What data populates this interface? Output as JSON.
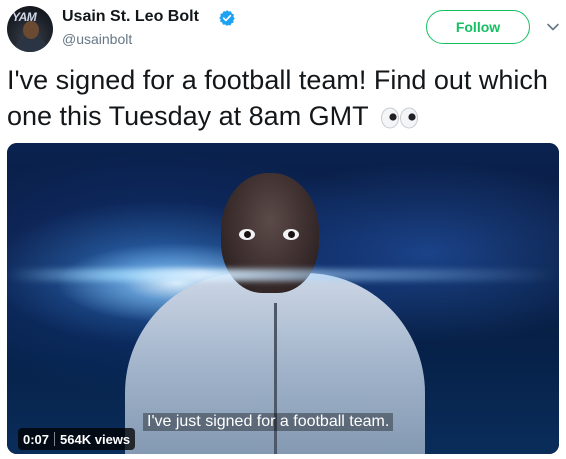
{
  "user": {
    "display_name": "Usain St. Leo Bolt",
    "handle": "@usainbolt",
    "avatar_text": "YAM",
    "verified": true
  },
  "actions": {
    "follow_label": "Follow",
    "more_icon": "chevron-down-icon"
  },
  "tweet": {
    "text": "I've signed for a football team! Find out which one this Tuesday at 8am GMT",
    "emoji": "eyes-emoji"
  },
  "media": {
    "subtitle": "I've just signed for a football team.",
    "duration": "0:07",
    "views": "564K views"
  },
  "colors": {
    "accent_green": "#17bf63",
    "verified_blue": "#1da1f2",
    "text_primary": "#14171a",
    "text_secondary": "#657786"
  }
}
